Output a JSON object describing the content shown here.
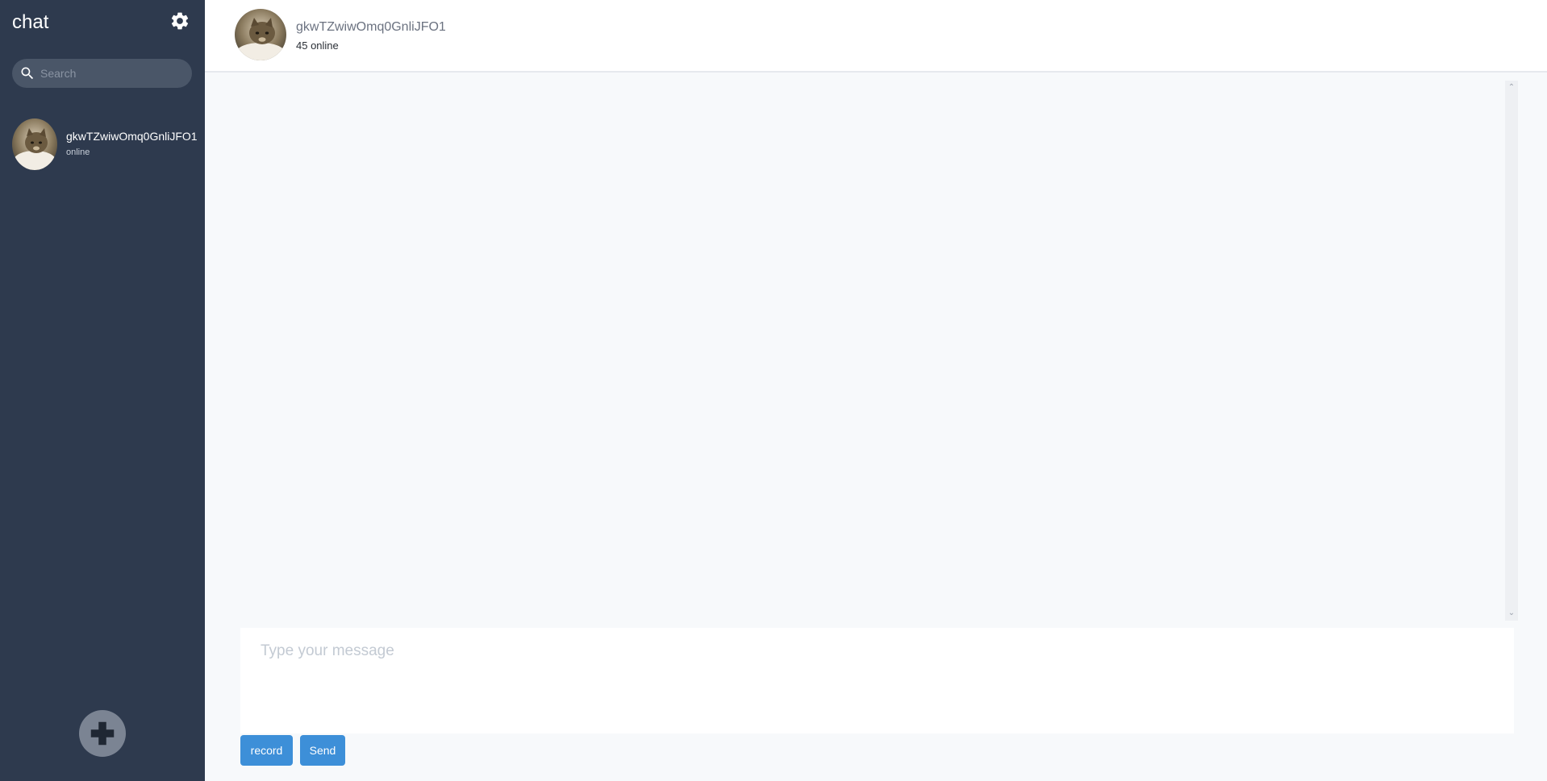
{
  "sidebar": {
    "title": "chat",
    "search": {
      "placeholder": "Search",
      "value": ""
    },
    "contacts": [
      {
        "name": "gkwTZwiwOmq0GnliJFO1",
        "status": "online"
      }
    ]
  },
  "header": {
    "name": "gkwTZwiwOmq0GnliJFO1",
    "status": "45 online"
  },
  "composer": {
    "placeholder": "Type your message",
    "value": ""
  },
  "actions": {
    "record_label": "record",
    "send_label": "Send"
  },
  "icons": {
    "settings": "gear-icon",
    "search": "search-icon",
    "add": "plus-icon",
    "scroll_up": "chevron-up-icon",
    "scroll_down": "chevron-down-icon"
  },
  "colors": {
    "sidebar_bg": "#2e3a4e",
    "accent": "#3d8fd8",
    "search_bg": "#4a5668",
    "add_button_bg": "#7b8493"
  }
}
